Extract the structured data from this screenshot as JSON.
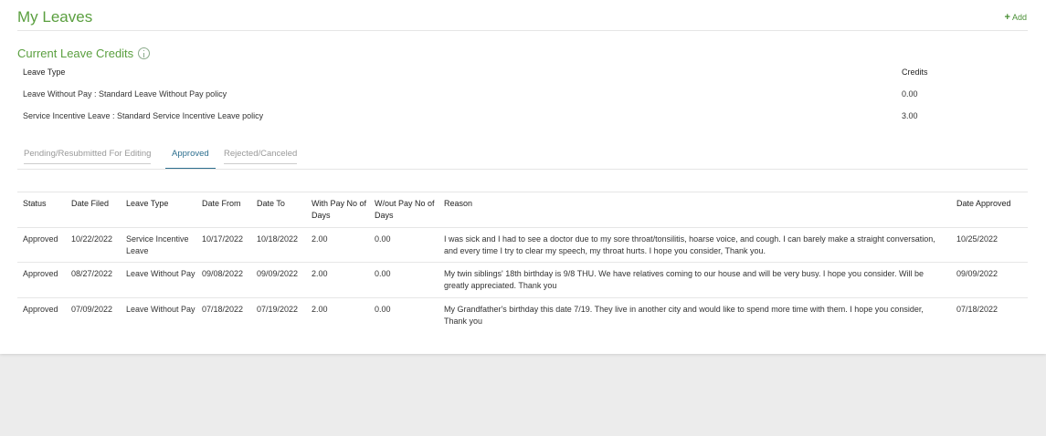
{
  "header": {
    "title": "My Leaves",
    "add_label": "Add"
  },
  "credits": {
    "title": "Current Leave Credits",
    "columns": [
      "Leave Type",
      "Credits"
    ],
    "rows": [
      {
        "type": "Leave Without Pay : Standard Leave Without Pay policy",
        "credits": "0.00"
      },
      {
        "type": "Service Incentive Leave : Standard Service Incentive Leave policy",
        "credits": "3.00"
      }
    ]
  },
  "tabs": [
    {
      "label": "Pending/Resubmitted For Editing",
      "active": false
    },
    {
      "label": "Approved",
      "active": true
    },
    {
      "label": "Rejected/Canceled",
      "active": false
    }
  ],
  "table": {
    "columns": {
      "status": "Status",
      "date_filed": "Date Filed",
      "leave_type": "Leave Type",
      "date_from": "Date From",
      "date_to": "Date To",
      "with_pay": "With Pay No of Days",
      "without_pay": "W/out Pay No of Days",
      "reason": "Reason",
      "date_approved": "Date Approved"
    },
    "rows": [
      {
        "status": "Approved",
        "date_filed": "10/22/2022",
        "leave_type": "Service Incentive Leave",
        "date_from": "10/17/2022",
        "date_to": "10/18/2022",
        "with_pay": "2.00",
        "without_pay": "0.00",
        "reason": "I was sick and I had to see a doctor due to my sore throat/tonsilitis, hoarse voice, and cough. I can barely make a straight conversation, and every time I try to clear my speech, my throat hurts. I hope you consider, Thank you.",
        "date_approved": "10/25/2022"
      },
      {
        "status": "Approved",
        "date_filed": "08/27/2022",
        "leave_type": "Leave Without Pay",
        "date_from": "09/08/2022",
        "date_to": "09/09/2022",
        "with_pay": "2.00",
        "without_pay": "0.00",
        "reason": "My twin siblings' 18th birthday is 9/8 THU. We have relatives coming to our house and will be very busy. I hope you consider. Will be greatly appreciated. Thank you",
        "date_approved": "09/09/2022"
      },
      {
        "status": "Approved",
        "date_filed": "07/09/2022",
        "leave_type": "Leave Without Pay",
        "date_from": "07/18/2022",
        "date_to": "07/19/2022",
        "with_pay": "2.00",
        "without_pay": "0.00",
        "reason": "My Grandfather's birthday this date 7/19. They live in another city and would like to spend more time with them. I hope you consider, Thank you",
        "date_approved": "07/18/2022"
      }
    ]
  },
  "colors": {
    "accent_green": "#5a9f3f",
    "active_tab": "#2d6f8f",
    "background": "#ececec"
  }
}
